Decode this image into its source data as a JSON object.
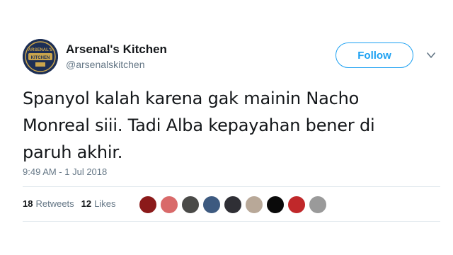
{
  "author": {
    "name": "Arsenal's Kitchen",
    "handle": "@arsenalskitchen",
    "avatar_text": "ARSENAL'S KITCHEN"
  },
  "actions": {
    "follow_label": "Follow"
  },
  "tweet": {
    "text": "Spanyol kalah karena gak mainin Nacho\nMonreal siii. Tadi Alba kepayahan bener di\nparuh akhir.",
    "timestamp": "9:49 AM - 1 Jul 2018"
  },
  "stats": {
    "retweets_count": "18",
    "retweets_label": "Retweets",
    "likes_count": "12",
    "likes_label": "Likes"
  },
  "likers": [
    {
      "color": "#8b1a1a"
    },
    {
      "color": "#d96a6a"
    },
    {
      "color": "#4a4a48"
    },
    {
      "color": "#3d5a80"
    },
    {
      "color": "#2f2f35"
    },
    {
      "color": "#b8a898"
    },
    {
      "color": "#0a0a0a"
    },
    {
      "color": "#c0282a"
    },
    {
      "color": "#9a9a9a"
    }
  ],
  "colors": {
    "accent": "#1da1f2",
    "secondary_text": "#657786",
    "primary_text": "#14171a"
  }
}
